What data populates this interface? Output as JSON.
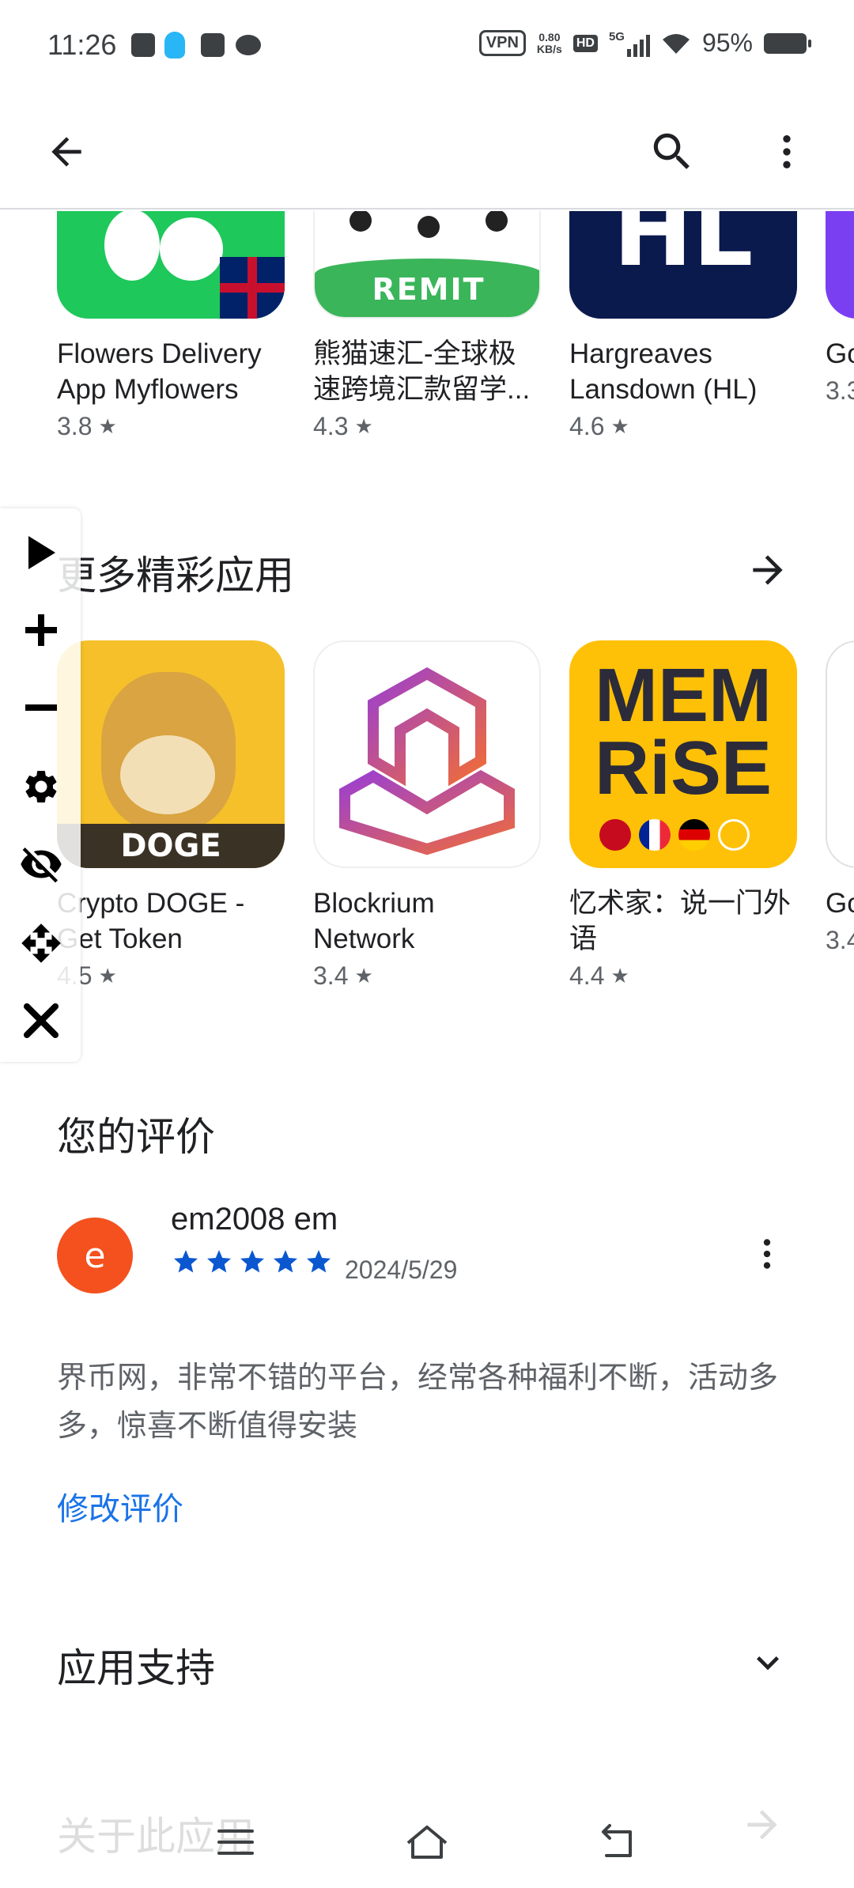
{
  "status_bar": {
    "time": "11:26",
    "vpn": "VPN",
    "speed_value": "0.80",
    "speed_unit": "KB/s",
    "hd": "HD",
    "network": "5G",
    "battery": "95%"
  },
  "top_apps": [
    {
      "name": "Flowers Delivery App Myflowers",
      "rating": "3.8"
    },
    {
      "name": "熊猫速汇-全球极速跨境汇款留学...",
      "rating": "4.3",
      "icon_text": "REMIT"
    },
    {
      "name": "Hargreaves Lansdown (HL)",
      "rating": "4.6",
      "icon_text": "HL"
    },
    {
      "name": "Go",
      "rating": "3.3"
    }
  ],
  "more_apps": {
    "title": "更多精彩应用",
    "apps": [
      {
        "name": "Crypto DOGE - Get Token",
        "rating": "4.5",
        "icon_text": "DOGE"
      },
      {
        "name": "Blockrium Network",
        "rating": "3.4"
      },
      {
        "name": "忆术家：说一门外语",
        "rating": "4.4",
        "icon_text_1": "MEM",
        "icon_text_2": "RiSE"
      },
      {
        "name": "Go Au",
        "rating": "3.4"
      }
    ]
  },
  "your_review": {
    "title": "您的评价",
    "avatar_letter": "e",
    "reviewer": "em2008 em",
    "stars": 5,
    "date": "2024/5/29",
    "text": "界币网，非常不错的平台，经常各种福利不断，活动多多，惊喜不断值得安装",
    "edit_label": "修改评价"
  },
  "app_support": {
    "title": "应用支持"
  },
  "about": {
    "title": "关于此应用"
  },
  "colors": {
    "accent": "#1a73e8",
    "star_blue": "#0b57d0",
    "avatar": "#f4511e",
    "flowers_green": "#1ec85b",
    "remit_green": "#3bb55a",
    "hl_navy": "#0b1a4d",
    "doge_yellow": "#f5c02a",
    "memrise_yellow": "#ffc107"
  }
}
